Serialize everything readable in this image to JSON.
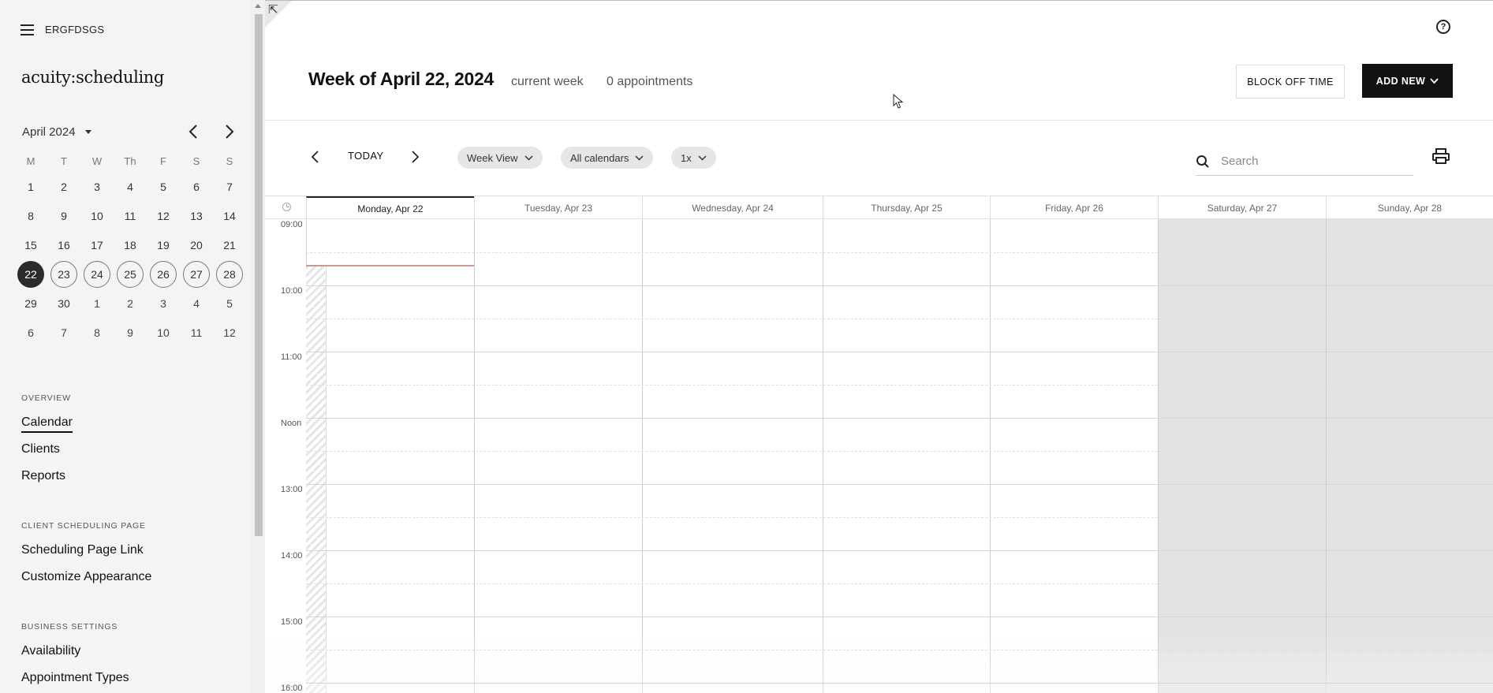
{
  "sidebar": {
    "account_name": "ERGFDSGS",
    "logo_text": "acuity:scheduling",
    "mini_calendar": {
      "month_label": "April 2024",
      "weekdays": [
        "M",
        "T",
        "W",
        "Th",
        "F",
        "S",
        "S"
      ],
      "weeks": [
        [
          "1",
          "2",
          "3",
          "4",
          "5",
          "6",
          "7"
        ],
        [
          "8",
          "9",
          "10",
          "11",
          "12",
          "13",
          "14"
        ],
        [
          "15",
          "16",
          "17",
          "18",
          "19",
          "20",
          "21"
        ],
        [
          "22",
          "23",
          "24",
          "25",
          "26",
          "27",
          "28"
        ],
        [
          "29",
          "30",
          "1",
          "2",
          "3",
          "4",
          "5"
        ],
        [
          "6",
          "7",
          "8",
          "9",
          "10",
          "11",
          "12"
        ]
      ],
      "selected_day": "22"
    },
    "sections": [
      {
        "heading": "OVERVIEW",
        "items": [
          "Calendar",
          "Clients",
          "Reports"
        ]
      },
      {
        "heading": "CLIENT SCHEDULING PAGE",
        "items": [
          "Scheduling Page Link",
          "Customize Appearance"
        ]
      },
      {
        "heading": "BUSINESS SETTINGS",
        "items": [
          "Availability",
          "Appointment Types"
        ]
      }
    ],
    "active_item": "Calendar"
  },
  "header": {
    "title": "Week of April 22, 2024",
    "subtitle": "current week",
    "appointments": "0 appointments",
    "block_off_label": "BLOCK OFF TIME",
    "add_new_label": "ADD NEW",
    "help_icon": "?"
  },
  "toolbar": {
    "today_label": "TODAY",
    "view_label": "Week View",
    "calendars_label": "All calendars",
    "zoom_label": "1x",
    "search_placeholder": "Search"
  },
  "calendar": {
    "days": [
      "Monday, Apr 22",
      "Tuesday, Apr 23",
      "Wednesday, Apr 24",
      "Thursday, Apr 25",
      "Friday, Apr 26",
      "Saturday, Apr 27",
      "Sunday, Apr 28"
    ],
    "hours": [
      "09:00",
      "10:00",
      "11:00",
      "Noon",
      "13:00",
      "14:00",
      "15:00",
      "16:00"
    ]
  }
}
